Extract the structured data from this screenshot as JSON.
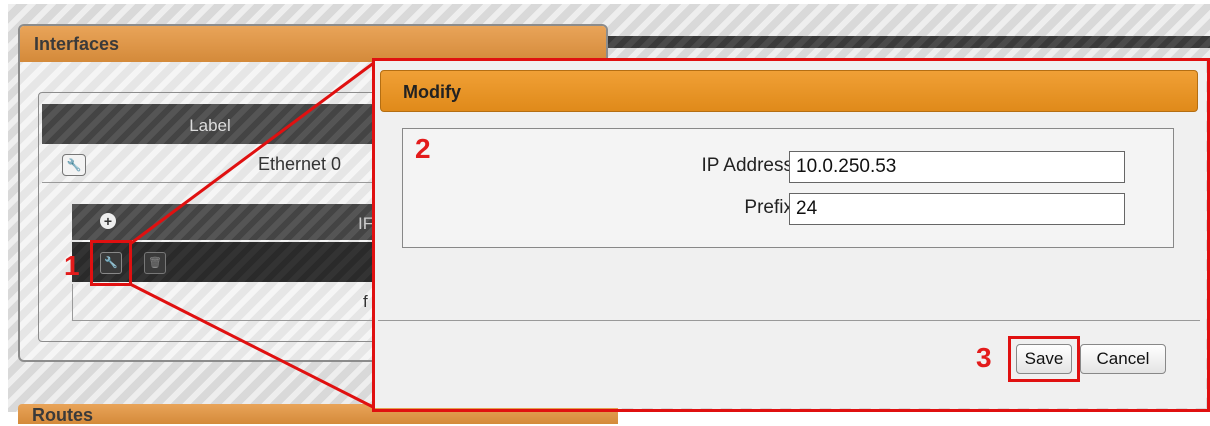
{
  "interfaces": {
    "title": "Interfaces",
    "label_column": "Label",
    "ethernet_label": "Ethernet 0",
    "ip_column_partial": "IF",
    "bottom_partial": "f"
  },
  "routes": {
    "title": "Routes"
  },
  "modal": {
    "title": "Modify",
    "ip_label": "IP Address",
    "ip_value": "10.0.250.53",
    "prefix_label": "Prefix",
    "prefix_value": "24",
    "save_label": "Save",
    "cancel_label": "Cancel"
  },
  "callouts": {
    "one": "1",
    "two": "2",
    "three": "3"
  },
  "colors": {
    "accent_orange": "#e08a1a",
    "highlight_red": "#e01010"
  }
}
